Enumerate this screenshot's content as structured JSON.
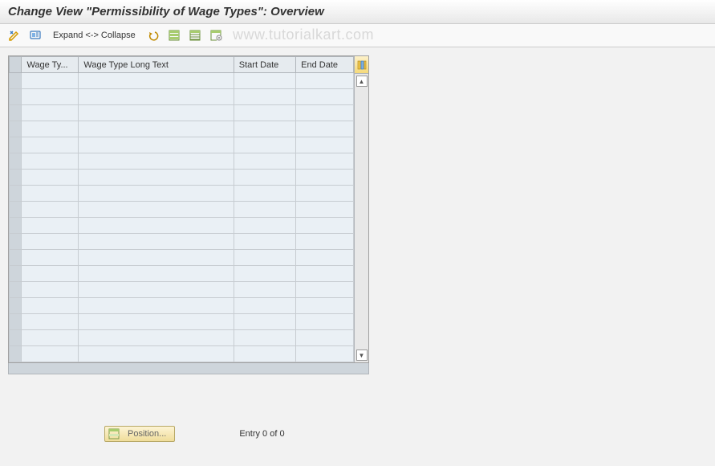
{
  "title": "Change View \"Permissibility of Wage Types\": Overview",
  "toolbar": {
    "expand_collapse_label": "Expand <-> Collapse"
  },
  "watermark": "www.tutorialkart.com",
  "table": {
    "columns": {
      "wage_type": "Wage Ty...",
      "long_text": "Wage Type Long Text",
      "start_date": "Start Date",
      "end_date": "End Date"
    },
    "rows": [
      {
        "wage_type": "",
        "long_text": "",
        "start_date": "",
        "end_date": ""
      },
      {
        "wage_type": "",
        "long_text": "",
        "start_date": "",
        "end_date": ""
      },
      {
        "wage_type": "",
        "long_text": "",
        "start_date": "",
        "end_date": ""
      },
      {
        "wage_type": "",
        "long_text": "",
        "start_date": "",
        "end_date": ""
      },
      {
        "wage_type": "",
        "long_text": "",
        "start_date": "",
        "end_date": ""
      },
      {
        "wage_type": "",
        "long_text": "",
        "start_date": "",
        "end_date": ""
      },
      {
        "wage_type": "",
        "long_text": "",
        "start_date": "",
        "end_date": ""
      },
      {
        "wage_type": "",
        "long_text": "",
        "start_date": "",
        "end_date": ""
      },
      {
        "wage_type": "",
        "long_text": "",
        "start_date": "",
        "end_date": ""
      },
      {
        "wage_type": "",
        "long_text": "",
        "start_date": "",
        "end_date": ""
      },
      {
        "wage_type": "",
        "long_text": "",
        "start_date": "",
        "end_date": ""
      },
      {
        "wage_type": "",
        "long_text": "",
        "start_date": "",
        "end_date": ""
      },
      {
        "wage_type": "",
        "long_text": "",
        "start_date": "",
        "end_date": ""
      },
      {
        "wage_type": "",
        "long_text": "",
        "start_date": "",
        "end_date": ""
      },
      {
        "wage_type": "",
        "long_text": "",
        "start_date": "",
        "end_date": ""
      },
      {
        "wage_type": "",
        "long_text": "",
        "start_date": "",
        "end_date": ""
      },
      {
        "wage_type": "",
        "long_text": "",
        "start_date": "",
        "end_date": ""
      },
      {
        "wage_type": "",
        "long_text": "",
        "start_date": "",
        "end_date": ""
      }
    ]
  },
  "footer": {
    "position_label": "Position...",
    "entry_text": "Entry 0 of 0"
  }
}
